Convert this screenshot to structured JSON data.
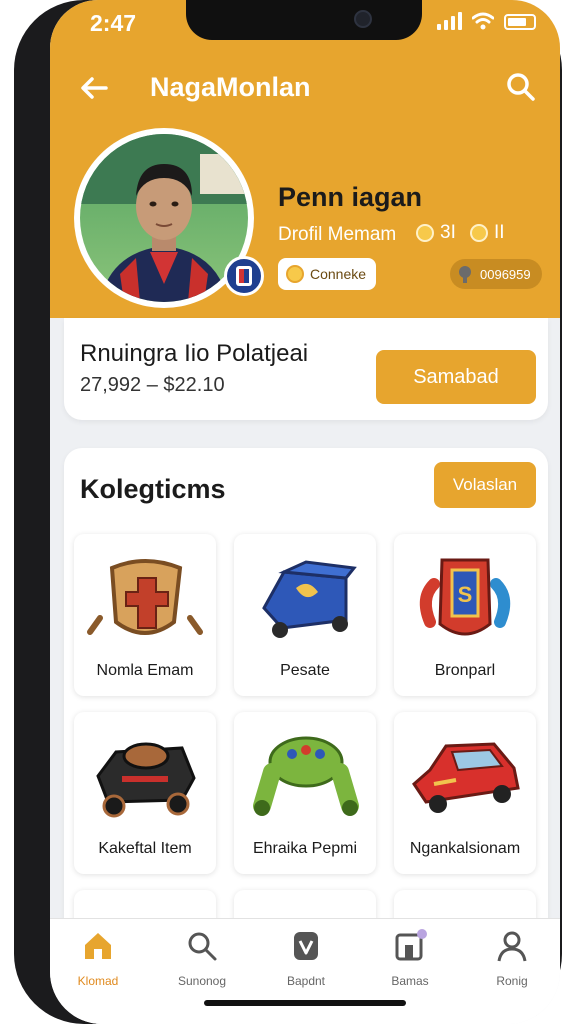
{
  "status": {
    "time": "2:47"
  },
  "header": {
    "title": "NagaMonlan"
  },
  "profile": {
    "name": "Penn iagan",
    "subtitle": "Drofil Memam",
    "stat_1": "3I",
    "stat_2": "II",
    "pill_left": "Conneke",
    "pill_right": "0096959"
  },
  "price": {
    "title": "Rnuingra Iio Polatjeai",
    "range": "27,992 – $22.10",
    "button": "Samabad"
  },
  "collections": {
    "title": "Kolegticms",
    "button": "Volaslan",
    "items": [
      {
        "label": "Nomla Emam",
        "icon": "shield-cross-icon"
      },
      {
        "label": "Pesate",
        "icon": "blue-cart-icon"
      },
      {
        "label": "Bronparl",
        "icon": "crest-icon"
      },
      {
        "label": "Kakeftal Item",
        "icon": "black-cart-icon"
      },
      {
        "label": "Ehraika Pepmi",
        "icon": "green-controller-icon"
      },
      {
        "label": "Ngankalsionam",
        "icon": "red-car-icon"
      }
    ]
  },
  "tabs": [
    {
      "label": "Klomad",
      "icon": "home-icon"
    },
    {
      "label": "Sunonog",
      "icon": "search-icon"
    },
    {
      "label": "Bapdnt",
      "icon": "badge-icon"
    },
    {
      "label": "Bamas",
      "icon": "game-icon"
    },
    {
      "label": "Ronig",
      "icon": "profile-icon"
    }
  ],
  "colors": {
    "accent": "#e7a52e",
    "tab_active": "#e08a1e"
  }
}
